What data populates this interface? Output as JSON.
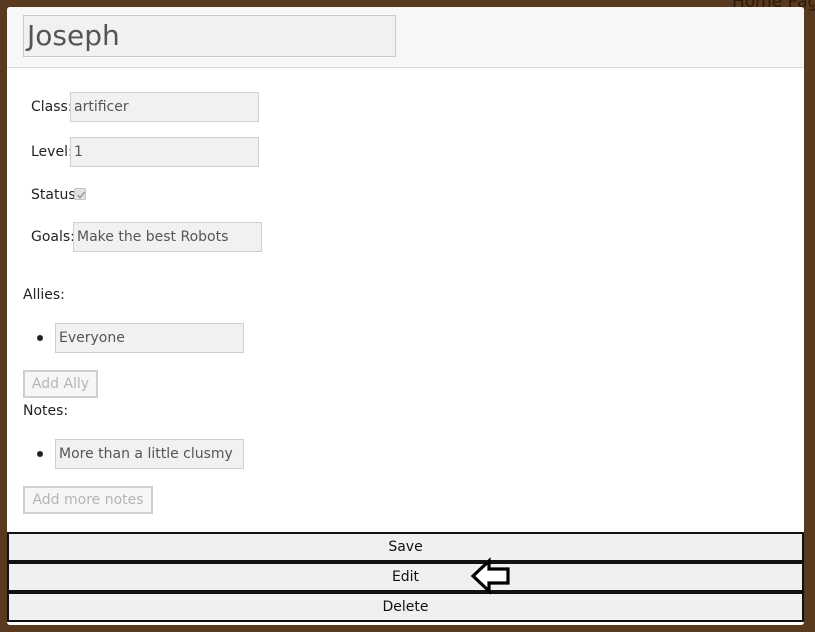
{
  "background": {
    "partial_link_text": "Home Pag"
  },
  "character": {
    "name": "Joseph",
    "class_label": "Class:",
    "class_value": "artificer",
    "level_label": "Level:",
    "level_value": "1",
    "status_label": "Status",
    "status_checked": true,
    "goals_label": "Goals:",
    "goals_value": "Make the best Robots"
  },
  "allies": {
    "label": "Allies:",
    "items": [
      "Everyone"
    ],
    "add_button": "Add Ally"
  },
  "notes": {
    "label": "Notes:",
    "items": [
      "More than a little clusmy"
    ],
    "add_button": "Add more notes"
  },
  "actions": {
    "save": "Save",
    "edit": "Edit",
    "delete": "Delete"
  },
  "pointer": {
    "icon": "left-arrow-icon",
    "target": "Edit"
  },
  "colors": {
    "page_background": "#5a3a1e",
    "modal_background": "#ffffff",
    "input_background": "#f1f1f1",
    "button_border": "#111111"
  }
}
